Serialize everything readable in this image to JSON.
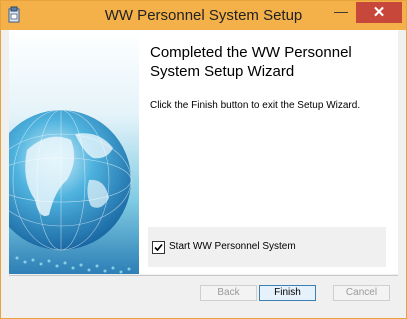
{
  "window": {
    "title": "WW Personnel System Setup",
    "minimize_glyph": "—",
    "close_glyph": "✕",
    "icon": "installer-icon"
  },
  "wizard": {
    "heading": "Completed the WW Personnel System Setup Wizard",
    "description": "Click the Finish button to exit the Setup Wizard.",
    "launch_option": {
      "label": "Start WW Personnel System",
      "checked": true
    }
  },
  "buttons": {
    "back": "Back",
    "finish": "Finish",
    "cancel": "Cancel"
  },
  "colors": {
    "titlebar": "#f4b14a",
    "close_button": "#c7483a",
    "banner_sky": "#4fb8d8"
  }
}
